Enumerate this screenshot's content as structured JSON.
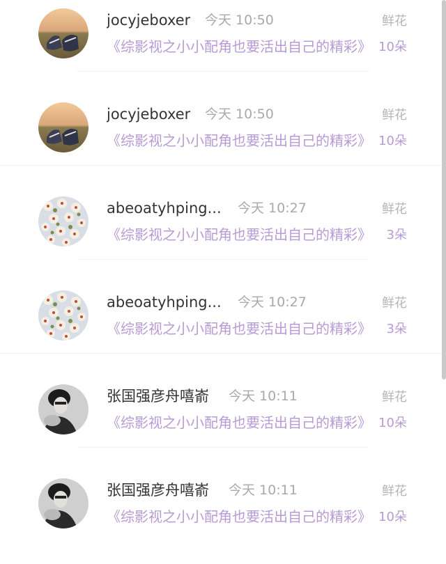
{
  "messages": [
    {
      "username": "jocyjeboxer",
      "time": "今天 10:50",
      "story": "《综影视之小小配角也要活出自己的精彩》",
      "gift_label": "鲜花",
      "gift_count": "10朵",
      "avatar": "sneakers-avatar-icon"
    },
    {
      "username": "jocyjeboxer",
      "time": "今天 10:50",
      "story": "《综影视之小小配角也要活出自己的精彩》",
      "gift_label": "鲜花",
      "gift_count": "10朵",
      "avatar": "sneakers-avatar-icon"
    },
    {
      "username": "abeoatyhping...",
      "time": "今天 10:27",
      "story": "《综影视之小小配角也要活出自己的精彩》",
      "gift_label": "鲜花",
      "gift_count": "3朵",
      "avatar": "flower-pattern-avatar-icon"
    },
    {
      "username": "abeoatyhping...",
      "time": "今天 10:27",
      "story": "《综影视之小小配角也要活出自己的精彩》",
      "gift_label": "鲜花",
      "gift_count": "3朵",
      "avatar": "flower-pattern-avatar-icon"
    },
    {
      "username": "张国强彦舟嘻嵛",
      "time": "今天 10:11",
      "story": "《综影视之小小配角也要活出自己的精彩》",
      "gift_label": "鲜花",
      "gift_count": "10朵",
      "avatar": "portrait-avatar-icon"
    },
    {
      "username": "张国强彦舟嘻嵛",
      "time": "今天 10:11",
      "story": "《综影视之小小配角也要活出自己的精彩》",
      "gift_label": "鲜花",
      "gift_count": "10朵",
      "avatar": "portrait-avatar-icon"
    }
  ],
  "colors": {
    "accent_purple": "#b89ad6",
    "username": "#333333",
    "muted": "#a9a9a9"
  }
}
